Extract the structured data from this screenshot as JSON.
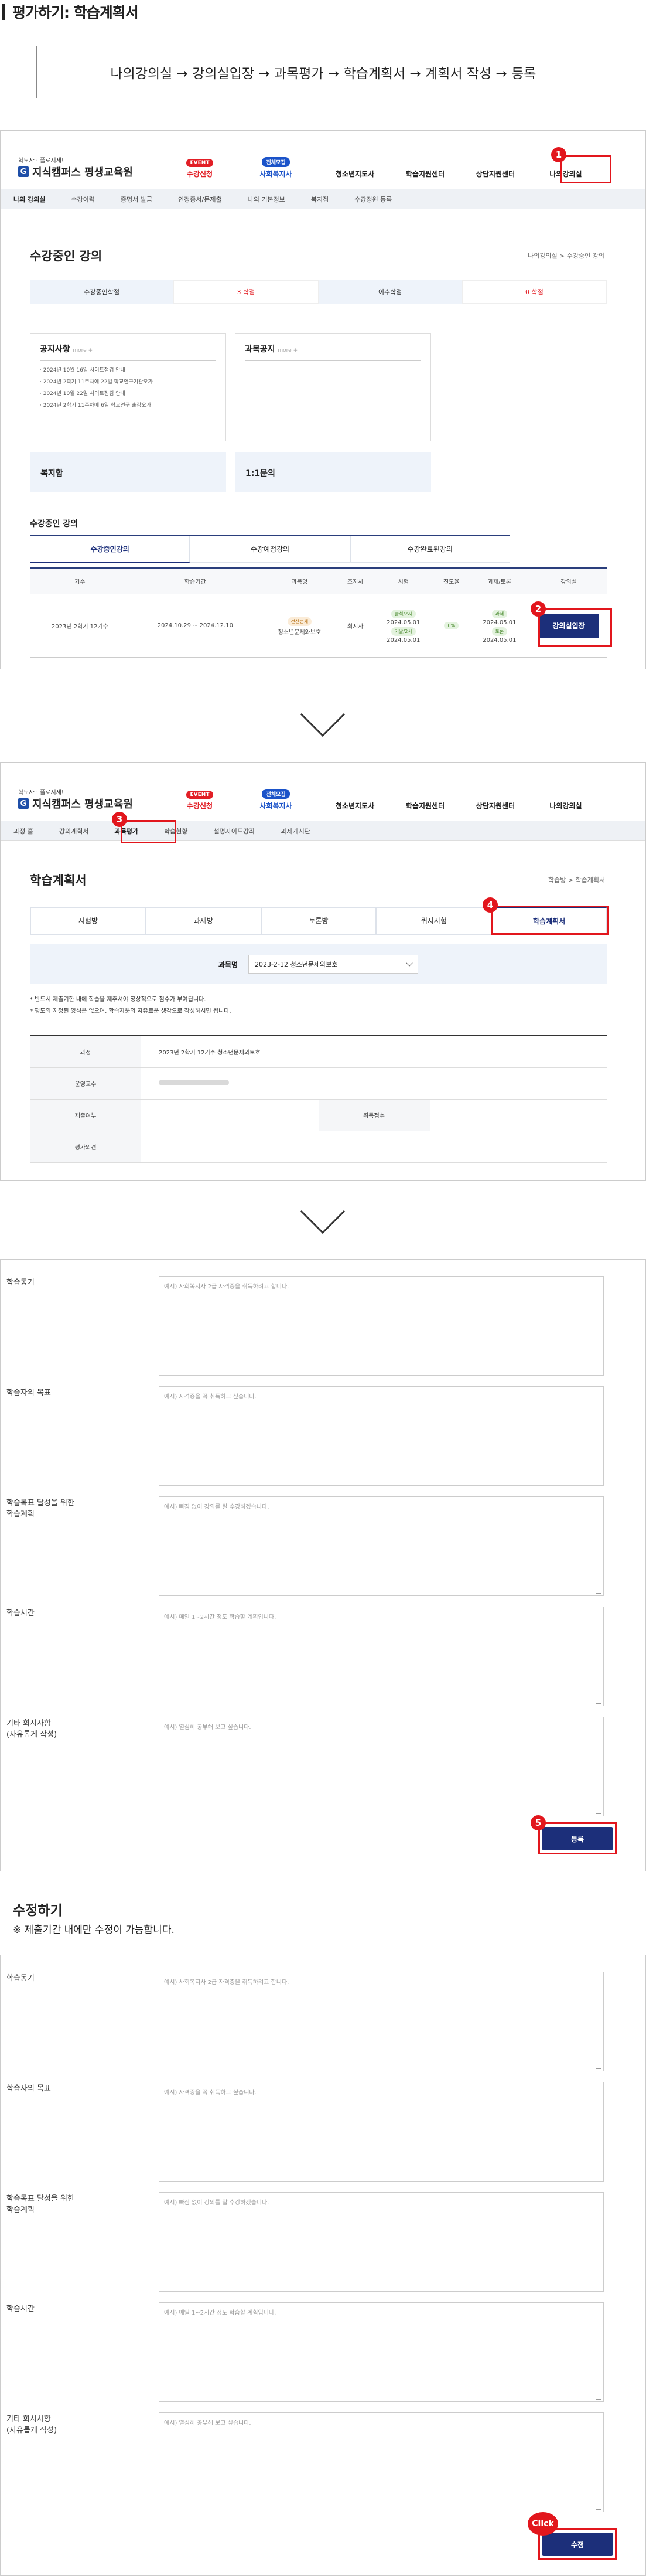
{
  "header": {
    "title": "평가하기: 학습계획서"
  },
  "flow": {
    "text": "나의강의실 → 강의실입장 → 과목평가 → 학습계획서 → 계획서 작성 → 등록"
  },
  "site": {
    "tagline": "학도사 · 플로지세!",
    "name": "지식캠퍼스 평생교육원"
  },
  "nav": {
    "items": [
      {
        "badge": "EVENT",
        "label": "수강신청"
      },
      {
        "badge": "전체모집",
        "label": "사회복지사"
      },
      {
        "label": "청소년지도사"
      },
      {
        "label": "학습지원센터"
      },
      {
        "label": "상담지원센터"
      },
      {
        "label": "나의강의실"
      }
    ]
  },
  "step1": {
    "subnav": [
      "나의 강의실",
      "수강이력",
      "증명서 발급",
      "인정증서/문제출",
      "나의 기본정보",
      "복지점",
      "수강정원 등록"
    ],
    "title": "수강중인 강의",
    "crumb": "나의강의실 > 수강중인 강의",
    "tabs": [
      {
        "label": "수강중인학점",
        "val": ""
      },
      {
        "label": "",
        "val": "3 학점"
      },
      {
        "label": "이수학점",
        "val": ""
      },
      {
        "label": "",
        "val": "0 학점"
      }
    ],
    "notice_title": "공지사항",
    "notice_more": "more +",
    "notices": [
      "· 2024년 10월 16일 사이트점검 안내",
      "· 2024년 2학기 11주차에 22일 학교연구기관오가",
      "· 2024년 10월 22일 사이트점검 안내",
      "· 2024년 2학기 11주차에 6일 학교연구 출강오가"
    ],
    "course_notice": "과목공지",
    "course_more": "more +",
    "box1": "복지함",
    "box2": "1:1문의",
    "list_title": "수강중인 강의",
    "list_tabs": [
      "수강중인강의",
      "수강예정강의",
      "수강완료된강의"
    ],
    "cols": [
      "기수",
      "학습기간",
      "과목명",
      "조지사",
      "시험",
      "진도율",
      "과제/토론",
      "강의실"
    ],
    "row": {
      "term": "2023년 2학기 12기수",
      "period": "2024.10.29 ~ 2024.12.10",
      "badge": "전산전체",
      "course": "청소년문제와보호",
      "prof": "최지사",
      "exam_a": "출석/2시",
      "exam_a_d": "2024.05.01",
      "exam_b": "기말/2시",
      "exam_b_d": "2024.05.01",
      "progress": "0%",
      "hw_a": "과제",
      "hw_a_d": "2024.05.01",
      "hw_b": "토론",
      "hw_b_d": "2024.05.01",
      "enter": "강의실입장"
    }
  },
  "step2": {
    "subnav": [
      "과정 홈",
      "강의계획서",
      "과목평가",
      "학습현황",
      "설명자이드강좌",
      "과제게시판"
    ],
    "title": "학습계획서",
    "crumb": "학습방 > 학습계획서",
    "tabs": [
      "시험방",
      "과제방",
      "토론방",
      "퀴지시험",
      "학습계획서"
    ],
    "subject_label": "과목명",
    "subject_value": "2023-2-12 청소년문제와보호",
    "notes": [
      "* 반드시 제출기한 내에 학습을 제추셔야 정상적으로 점수가 부여됩니다.",
      "* 평도의 지정된 양식은 없으며, 학습자분의 자유로운 생각으로 작성하시면 됩니다."
    ],
    "rows": [
      {
        "k": "과정",
        "v": "2023년 2학기 12기수 청소년문제와보호"
      },
      {
        "k": "운영교수",
        "v": ""
      },
      {
        "k": "제출여부",
        "v": "",
        "k2": "취득점수",
        "v2": ""
      },
      {
        "k": "평가의견",
        "v": ""
      }
    ]
  },
  "form": {
    "fields": [
      {
        "label": "학습동기",
        "ph": "예시) 사회복지사 2급 자격증을 취득하려고 합니다."
      },
      {
        "label": "학습자의 목표",
        "ph": "예시) 자격증을 꼭 취득하고 싶습니다."
      },
      {
        "label": "학습목표 달성을 위한\n학습계획",
        "ph": "예시) 빠짐 없이 강의를 잘 수강하겠습니다."
      },
      {
        "label": "학습시간",
        "ph": "예시) 매일 1~2시간 정도 학습할 계획입니다."
      },
      {
        "label": "기타 희시사항\n(자유롭게 작성)",
        "ph": "예시) 열심히 공부해 보고 싶습니다."
      }
    ],
    "submit": "등록"
  },
  "edit": {
    "title": "수정하기",
    "note": "※ 제출기간 내에만 수정이 가능합니다.",
    "fields": [
      {
        "label": "학습동기",
        "ph": "예시) 사회복지사 2급 자격증을 취득하려고 합니다."
      },
      {
        "label": "학습자의 목표",
        "ph": "예시) 자격증을 꼭 취득하고 싶습니다."
      },
      {
        "label": "학습목표 달성을 위한\n학습계획",
        "ph": "예시) 빠짐 없이 강의를 잘 수강하겠습니다."
      },
      {
        "label": "학습시간",
        "ph": "예시) 매일 1~2시간 정도 학습할 계획입니다."
      },
      {
        "label": "기타 희시사항\n(자유롭게 작성)",
        "ph": "예시) 열심히 공부해 보고 싶습니다."
      }
    ],
    "click": "Click",
    "submit": "수정"
  },
  "steps": {
    "s1": "1",
    "s2": "2",
    "s3": "3",
    "s4": "4",
    "s5": "5"
  }
}
